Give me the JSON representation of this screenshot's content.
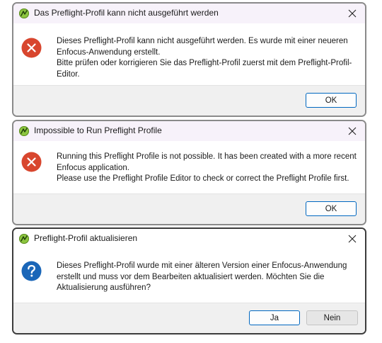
{
  "dialogs": [
    {
      "title": "Das Preflight-Profil kann nicht ausgeführt werden",
      "icon": "error-icon",
      "message_lines": [
        "Dieses Preflight-Profil kann nicht ausgeführt werden. Es wurde mit einer neueren Enfocus-Anwendung erstellt.",
        "Bitte prüfen oder korrigieren Sie das Preflight-Profil zuerst mit dem Preflight-Profil-Editor."
      ],
      "buttons": {
        "ok": "OK"
      }
    },
    {
      "title": "Impossible to Run Preflight Profile",
      "icon": "error-icon",
      "message_lines": [
        "Running this Preflight Profile is not possible. It has been created with a more recent Enfocus application.",
        "Please use the Preflight Profile Editor to check or correct the Preflight Profile first."
      ],
      "buttons": {
        "ok": "OK"
      }
    },
    {
      "title": "Preflight-Profil aktualisieren",
      "icon": "question-icon",
      "message_lines": [
        "Dieses Preflight-Profil wurde mit einer älteren Version einer Enfocus-Anwendung erstellt und muss vor dem Bearbeiten aktualisiert werden. Möchten Sie die Aktualisierung ausführen?"
      ],
      "buttons": {
        "yes": "Ja",
        "no": "Nein"
      }
    }
  ],
  "colors": {
    "error": "#d8462e",
    "question": "#1a66b8",
    "app_icon": "#8dc63f",
    "default_button_border": "#0067c0",
    "titlebar_inactive": "#f7f2fa"
  }
}
